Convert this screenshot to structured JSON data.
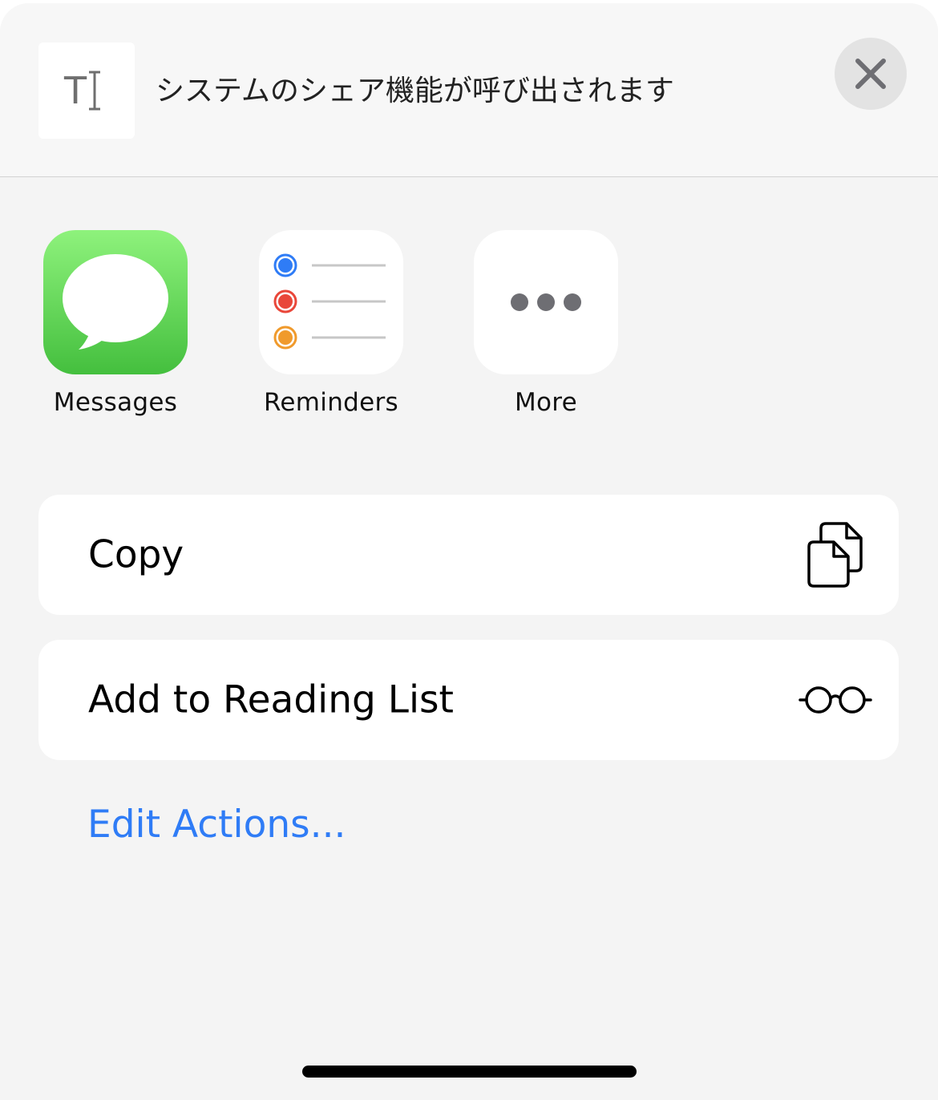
{
  "header": {
    "preview_title": "システムのシェア機能が呼び出されます",
    "preview_icon": "text-cursor-icon",
    "close_icon": "close-icon"
  },
  "apps": [
    {
      "label": "Messages",
      "icon": "messages-app-icon"
    },
    {
      "label": "Reminders",
      "icon": "reminders-app-icon"
    },
    {
      "label": "More",
      "icon": "more-icon"
    }
  ],
  "actions": [
    {
      "label": "Copy",
      "icon": "copy-icon"
    },
    {
      "label": "Add to Reading List",
      "icon": "reading-glasses-icon"
    }
  ],
  "edit_actions_label": "Edit Actions...",
  "colors": {
    "link": "#2f7cf6",
    "messages_green_top": "#8ef27c",
    "messages_green_bottom": "#44bf3e",
    "reminder_blue": "#2f7cf6",
    "reminder_red": "#e9473a",
    "reminder_orange": "#f09a2c"
  }
}
